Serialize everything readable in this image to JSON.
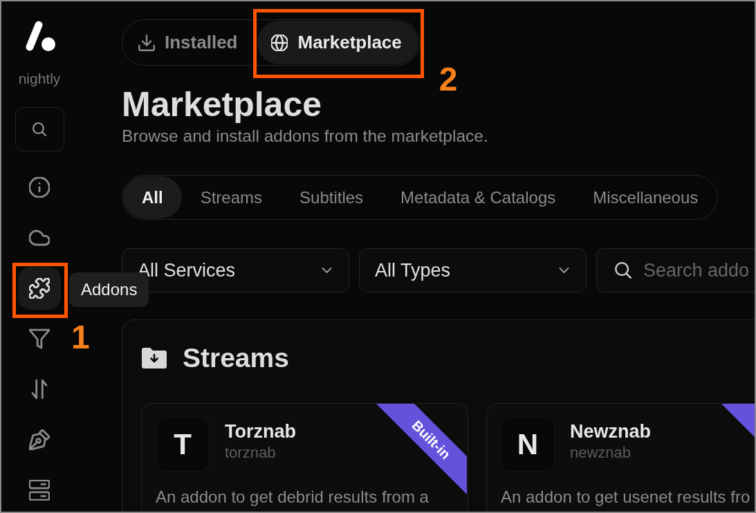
{
  "sidebar": {
    "brand_label": "nightly",
    "nav_items": [
      {
        "selected": false
      },
      {
        "selected": false
      },
      {
        "selected": true,
        "tooltip": "Addons",
        "annotation": "1"
      },
      {
        "selected": false
      },
      {
        "selected": false
      },
      {
        "selected": false
      },
      {
        "selected": false
      }
    ]
  },
  "tabs": [
    {
      "label": "Installed",
      "selected": false
    },
    {
      "label": "Marketplace",
      "selected": true,
      "annotation": "2"
    }
  ],
  "page": {
    "title": "Marketplace",
    "subtitle": "Browse and install addons from the marketplace."
  },
  "categories": [
    {
      "label": "All",
      "selected": true
    },
    {
      "label": "Streams",
      "selected": false
    },
    {
      "label": "Subtitles",
      "selected": false
    },
    {
      "label": "Metadata & Catalogs",
      "selected": false
    },
    {
      "label": "Miscellaneous",
      "selected": false
    }
  ],
  "filters": {
    "selects": [
      {
        "value": "All Services"
      },
      {
        "value": "All Types"
      }
    ],
    "search": {
      "placeholder": "Search addo"
    }
  },
  "section": {
    "title": "Streams",
    "addons": [
      {
        "initial": "T",
        "name": "Torznab",
        "id": "torznab",
        "description": "An addon to get debrid results from a",
        "builtin": true,
        "badge": "Built-in"
      },
      {
        "initial": "N",
        "name": "Newznab",
        "id": "newznab",
        "description": "An addon to get usenet results fro",
        "builtin": true
      }
    ]
  }
}
